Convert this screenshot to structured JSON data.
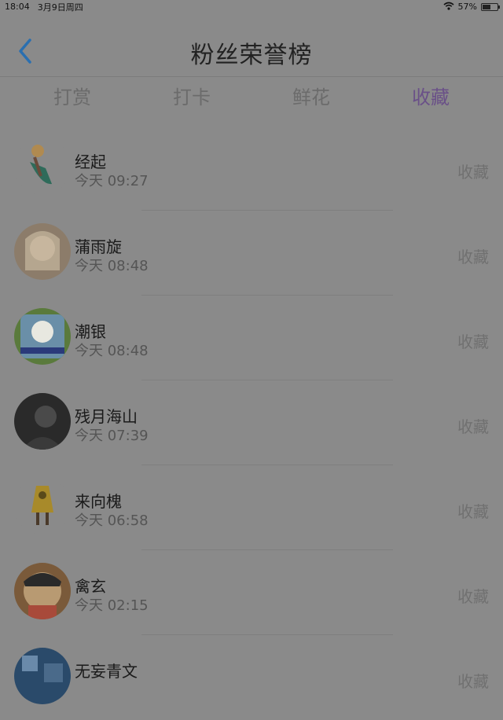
{
  "status_bar": {
    "time": "18:04",
    "date": "3月9日周四",
    "battery_percent": "57%",
    "battery_level": 0.57
  },
  "header": {
    "title": "粉丝荣誉榜",
    "back_icon": "chevron-left-icon"
  },
  "tabs": [
    {
      "label": "打赏",
      "active": false
    },
    {
      "label": "打卡",
      "active": false
    },
    {
      "label": "鲜花",
      "active": false
    },
    {
      "label": "收藏",
      "active": true
    }
  ],
  "colors": {
    "accent": "#6a5088",
    "back_icon": "#2a6fb0",
    "overlay": "#8a8a8a"
  },
  "fans": [
    {
      "name": "经起",
      "time": "今天 09:27",
      "action": "收藏"
    },
    {
      "name": "蒲雨旋",
      "time": "今天 08:48",
      "action": "收藏"
    },
    {
      "name": "潮银",
      "time": "今天 08:48",
      "action": "收藏"
    },
    {
      "name": "残月海山",
      "time": "今天 07:39",
      "action": "收藏"
    },
    {
      "name": "来向槐",
      "time": "今天 06:58",
      "action": "收藏"
    },
    {
      "name": "禽玄",
      "time": "今天 02:15",
      "action": "收藏"
    },
    {
      "name": "无妄青文",
      "time": "",
      "action": "收藏"
    }
  ]
}
